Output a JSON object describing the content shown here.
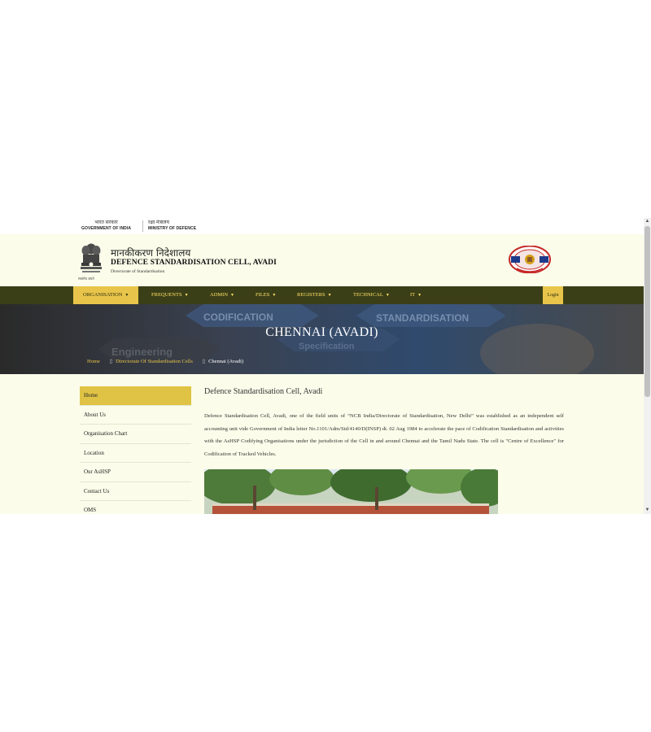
{
  "gov_strip": {
    "gov_hindi": "भारत सरकार",
    "gov_english": "GOVERNMENT OF INDIA",
    "ministry_hindi": "रक्षा मंत्रालय",
    "ministry_english": "MINISTRY OF DEFENCE"
  },
  "header": {
    "site_name_hindi": "मानकीकरण निदेशालय",
    "site_name": "DEFENCE STANDARDISATION CELL, AVADI",
    "site_subtitle": "Directorate of Standardisation",
    "emblem_motto": "सत्यमेव जयते"
  },
  "nav": {
    "items": [
      {
        "label": "ORGANISATION"
      },
      {
        "label": "FREQUENTS"
      },
      {
        "label": "ADMIN"
      },
      {
        "label": "FILES"
      },
      {
        "label": "REGISTERS"
      },
      {
        "label": "TECHNICAL"
      },
      {
        "label": "IT"
      }
    ],
    "login_label": "Login"
  },
  "banner": {
    "title": "CHENNAI (AVADI)",
    "bg_words": [
      "CODIFICATION",
      "STANDARDISATION",
      "Engineering",
      "Specification"
    ],
    "breadcrumb": {
      "home": "Home",
      "parent": "Directorate Of Standardisation Cells",
      "current": "Chennai (Avadi)"
    }
  },
  "sidebar": {
    "items": [
      {
        "label": "Home"
      },
      {
        "label": "About Us"
      },
      {
        "label": "Organisation Chart"
      },
      {
        "label": "Location"
      },
      {
        "label": "Our AsHSP"
      },
      {
        "label": "Contact Us"
      },
      {
        "label": "OMS"
      }
    ]
  },
  "main": {
    "title": "Defence Standardisation Cell, Avadi",
    "paragraph": "Defence Standardisation Cell, Avadi, one of the field units of “NCB India/Directorate of Standardisation, New Delhi” was established as an independent self accounting unit vide Government of India letter No.1101/Adm/Std/4140/D(INSP) dt. 02 Aug 1984 to accelerate the pace of Codification Standardisation and activities with the AsHSP Codifying Organisations under the jurisdiction of the Cell in and around Chennai and the Tamil Nadu State. The cell is \"Centre of Excellence\" for Codification of Tracked Vehicles."
  },
  "colors": {
    "nav_bg": "#3b3f17",
    "accent": "#e8c54a",
    "page_bg": "#fbfdea"
  }
}
